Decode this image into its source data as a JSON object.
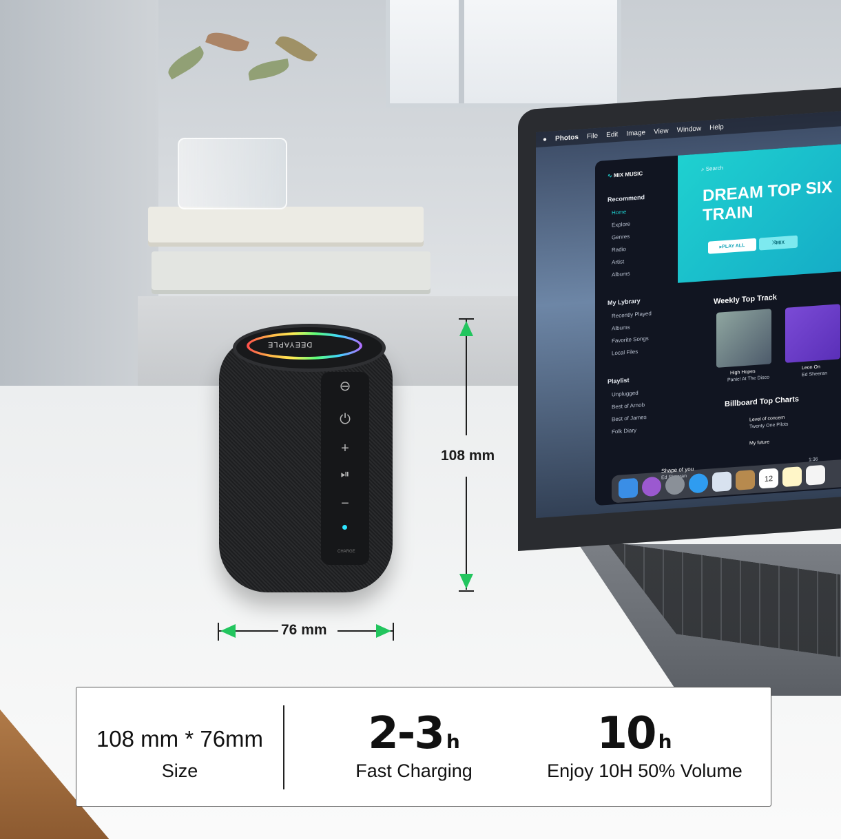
{
  "speaker": {
    "brand": "DEEYAPLE",
    "charge_label": "CHARGE"
  },
  "dimensions": {
    "height": "108 mm",
    "width": "76 mm"
  },
  "laptop": {
    "menubar": [
      "Photos",
      "File",
      "Edit",
      "Image",
      "View",
      "Window",
      "Help"
    ],
    "app_name": "MIX MUSIC",
    "search": "Search",
    "hero_title": "DREAM TOP SIX TRAIN",
    "play_all": "PLAY ALL",
    "mix": "MIX",
    "recommend_head": "Recommend",
    "recommend": [
      "Home",
      "Explore",
      "Genres",
      "Radio",
      "Artist",
      "Albums"
    ],
    "library_head": "My Lybrary",
    "library": [
      "Recently Played",
      "Albums",
      "Favorite Songs",
      "Local Files"
    ],
    "playlist_head": "Playlist",
    "playlist": [
      "Unplugged",
      "Best of Arnob",
      "Best of James",
      "Folk Diary"
    ],
    "weekly_title": "Weekly Top Track",
    "track1": {
      "title": "High Hopes",
      "artist": "Panic! At The Disco"
    },
    "track2": {
      "title": "Leon On",
      "artist": "Ed Sheeran"
    },
    "billboard_title": "Billboard Top Charts",
    "chart1": {
      "title": "Level of concern",
      "artist": "Twenty One Pilots"
    },
    "chart2": {
      "title": "My future"
    },
    "now_playing": {
      "title": "Shape of you",
      "artist": "Ed Sheeran",
      "time": "1:36"
    },
    "calendar_day": "12"
  },
  "specs": {
    "size_value": "108 mm * 76mm",
    "size_label": "Size",
    "charge_value": "2-3",
    "charge_unit": "h",
    "charge_label": "Fast Charging",
    "play_value": "10",
    "play_unit": "h",
    "play_label": "Enjoy 10H 50% Volume"
  },
  "colors": {
    "arrow": "#22c55e",
    "hero": "#1fd1d0"
  }
}
